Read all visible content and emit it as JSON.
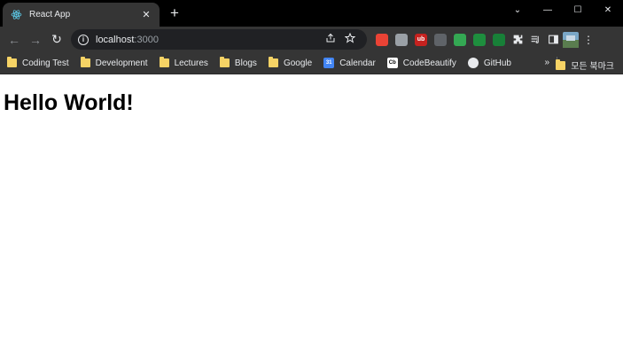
{
  "tab": {
    "title": "React App",
    "close_glyph": "✕",
    "favicon": "react-icon"
  },
  "new_tab_glyph": "+",
  "window_controls": {
    "menu": "⌄",
    "minimize": "—",
    "maximize": "☐",
    "close": "✕"
  },
  "toolbar": {
    "back": "←",
    "forward": "→",
    "reload": "↻",
    "url_host": "localhost",
    "url_port": ":3000",
    "share_icon": "share-icon",
    "star_icon": "star-icon",
    "menu_glyph": "⋮"
  },
  "extensions": [
    {
      "name": "ext-red-square",
      "color": "#ea4335",
      "label": ""
    },
    {
      "name": "ext-camera",
      "color": "#9aa0a6",
      "label": ""
    },
    {
      "name": "ext-ublock",
      "color": "#c5221f",
      "label": "ub"
    },
    {
      "name": "ext-gray",
      "color": "#5f6368",
      "label": ""
    },
    {
      "name": "ext-green-gear",
      "color": "#34a853",
      "label": ""
    },
    {
      "name": "ext-green-circle",
      "color": "#1e8e3e",
      "label": ""
    },
    {
      "name": "ext-tree",
      "color": "#188038",
      "label": ""
    }
  ],
  "bookmarks": [
    {
      "label": "Coding Test",
      "icon": "folder"
    },
    {
      "label": "Development",
      "icon": "folder"
    },
    {
      "label": "Lectures",
      "icon": "folder"
    },
    {
      "label": "Blogs",
      "icon": "folder"
    },
    {
      "label": "Google",
      "icon": "folder"
    },
    {
      "label": "Calendar",
      "icon": "calendar"
    },
    {
      "label": "CodeBeautify",
      "icon": "codebeautify"
    },
    {
      "label": "GitHub",
      "icon": "github"
    }
  ],
  "bookmarks_more": "»",
  "all_bookmarks_label": "모든 북마크",
  "page": {
    "heading": "Hello World!"
  }
}
